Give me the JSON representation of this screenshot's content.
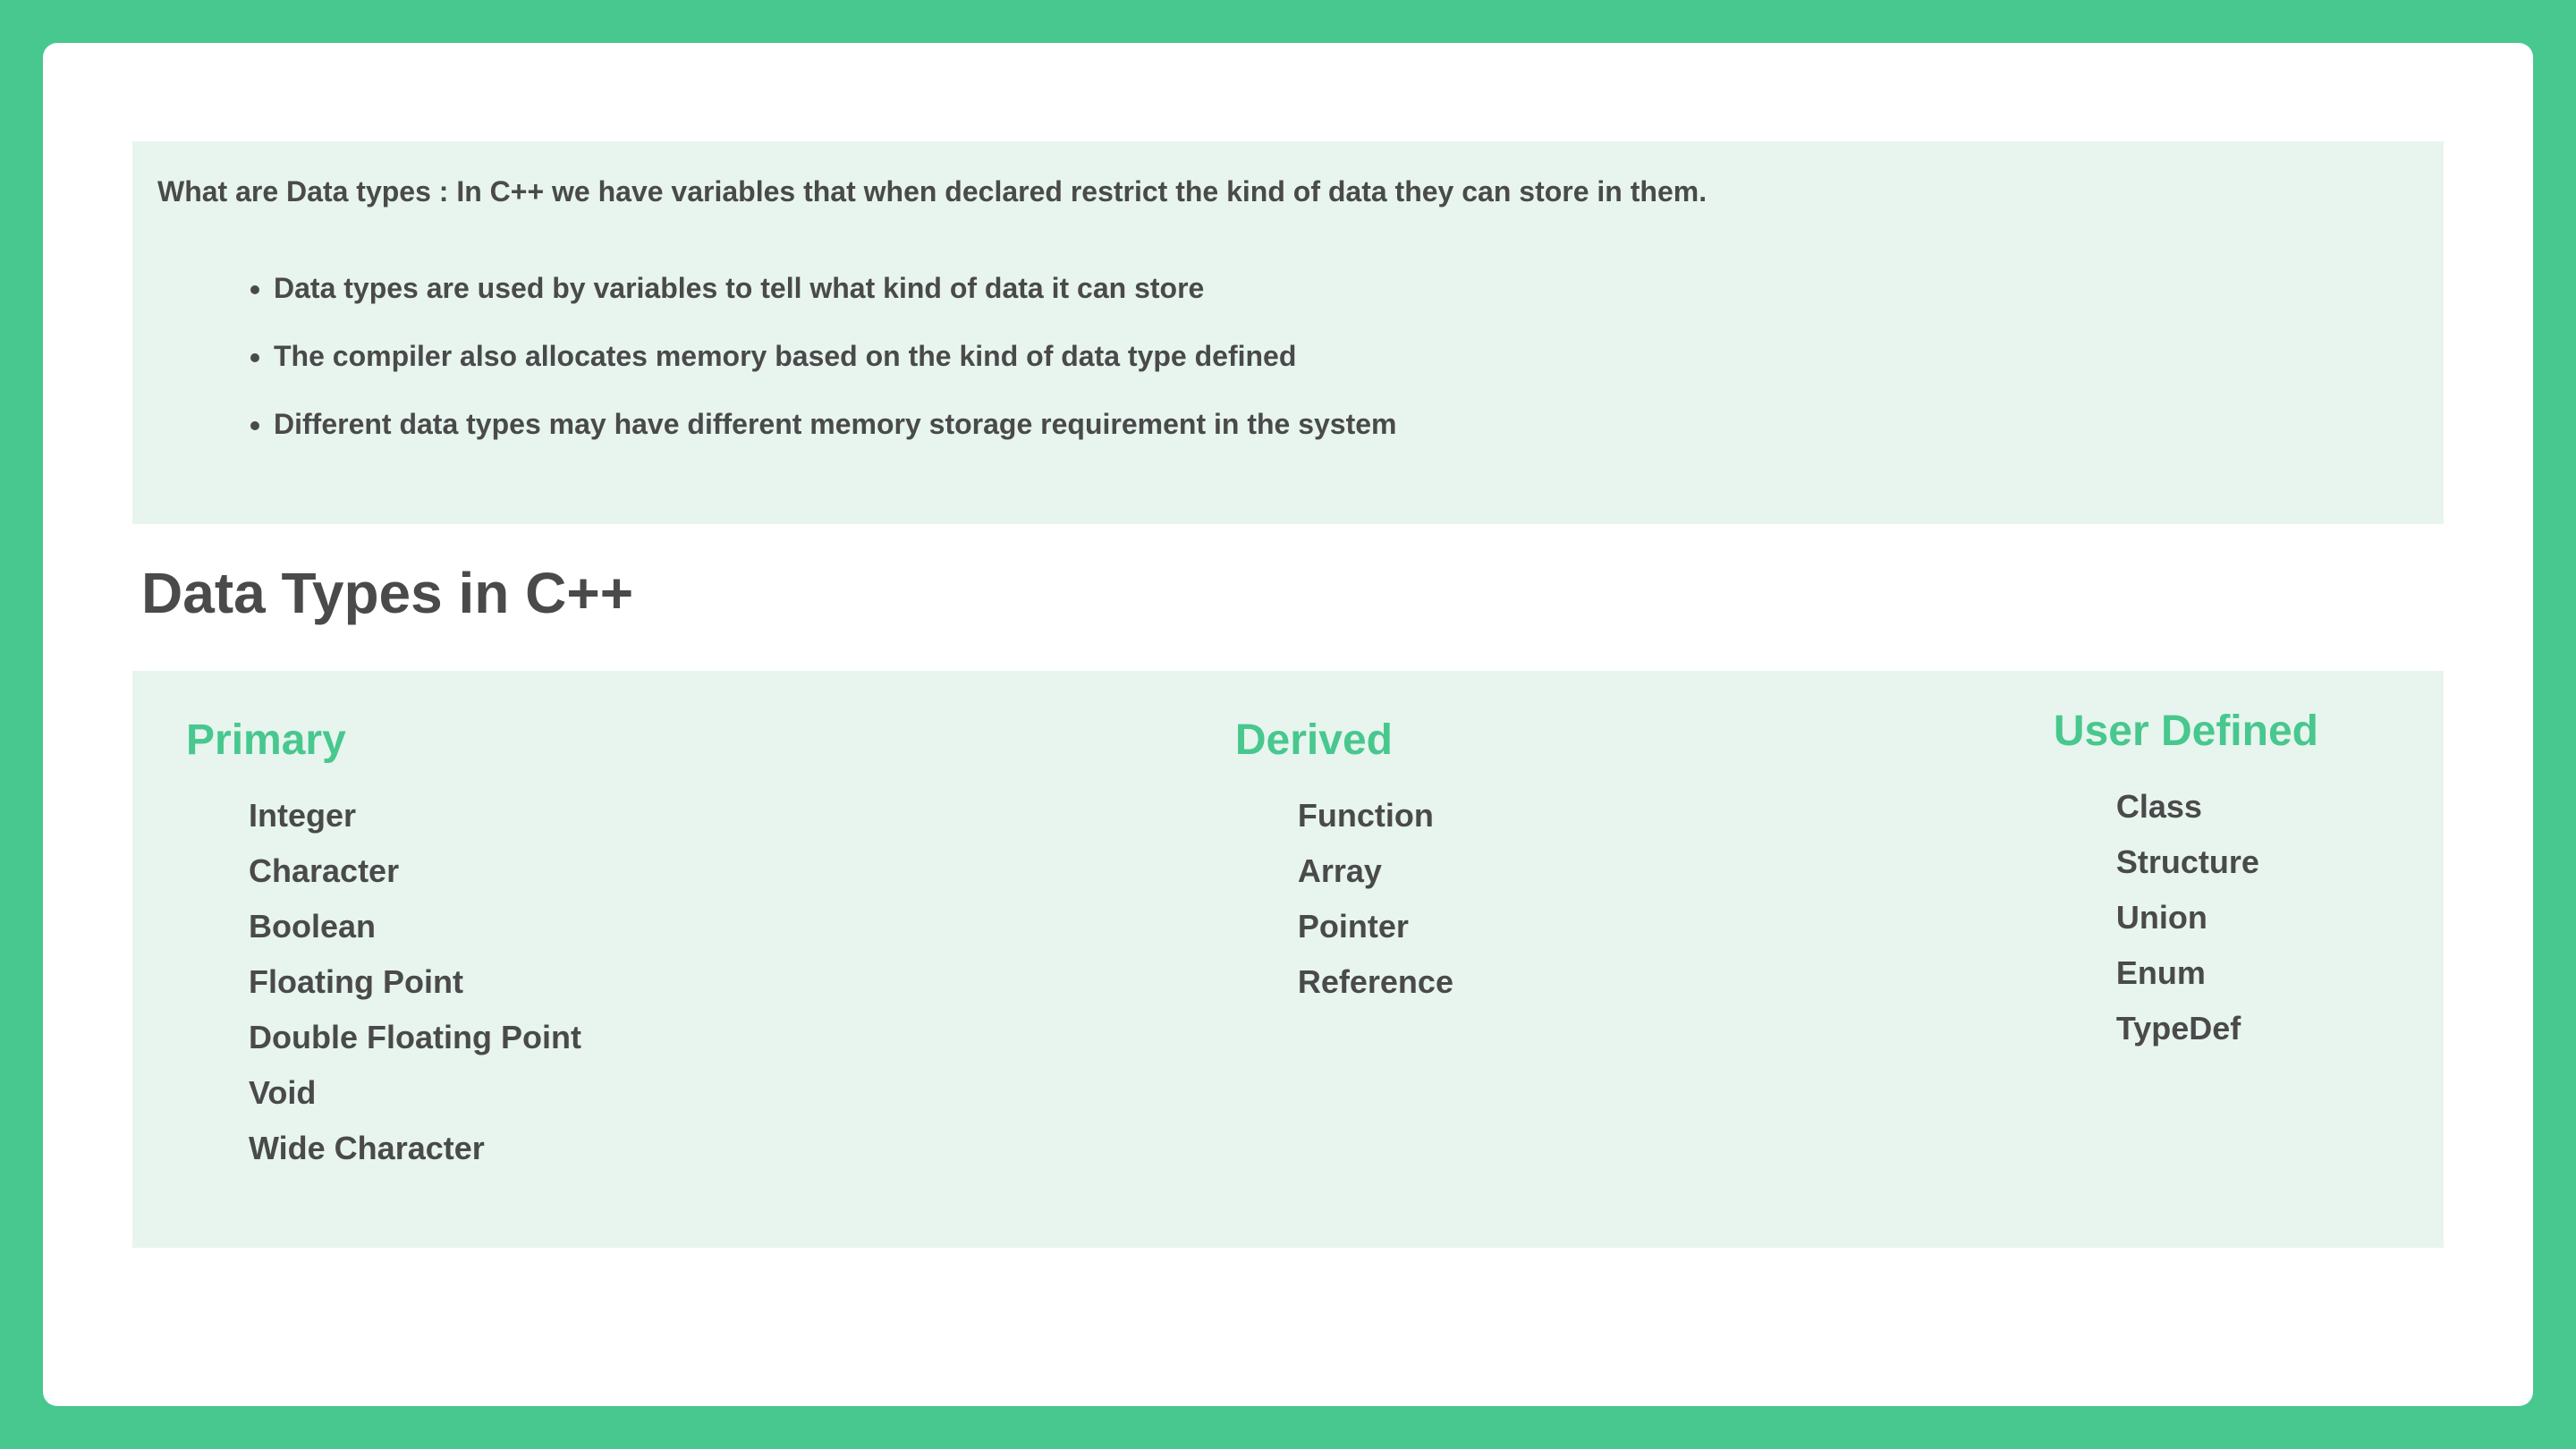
{
  "intro": {
    "label": "What are Data types",
    "text": " : In C++ we have variables that when declared restrict the kind of data they can store in them.",
    "bullets": [
      "Data types are used by variables to tell what kind of data it can store",
      "The compiler also allocates memory based on the kind of data type defined",
      "Different data types may have different memory storage requirement in the system"
    ]
  },
  "sectionTitle": "Data Types in C++",
  "columns": {
    "primary": {
      "heading": "Primary",
      "items": [
        "Integer",
        "Character",
        "Boolean",
        "Floating Point",
        "Double Floating Point",
        "Void",
        "Wide Character"
      ]
    },
    "derived": {
      "heading": "Derived",
      "items": [
        "Function",
        "Array",
        "Pointer",
        "Reference"
      ]
    },
    "userdefined": {
      "heading": "User Defined",
      "items": [
        "Class",
        "Structure",
        "Union",
        "Enum",
        "TypeDef"
      ]
    }
  }
}
